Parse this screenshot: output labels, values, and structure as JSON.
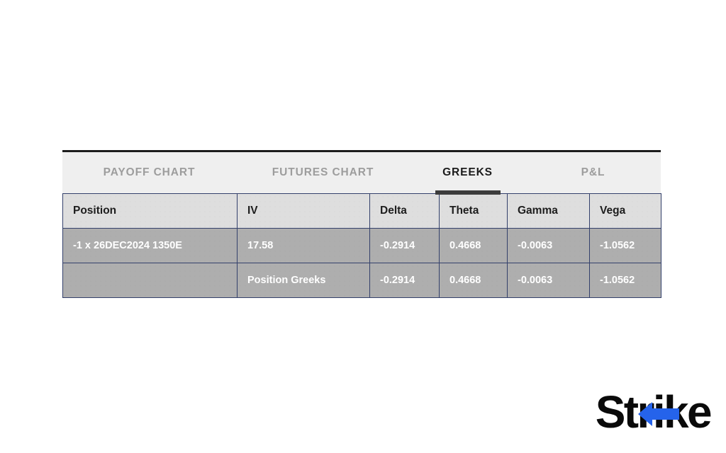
{
  "background": {
    "type": "world-map",
    "base_color": "#ffffff",
    "land_color": "#f1f2f4",
    "dot_color": "#e6e8ec"
  },
  "widget": {
    "tabs": [
      {
        "label": "PAYOFF CHART",
        "active": false,
        "name": "tab-payoff-chart"
      },
      {
        "label": "FUTURES CHART",
        "active": false,
        "name": "tab-futures-chart"
      },
      {
        "label": "GREEKS",
        "active": true,
        "name": "tab-greeks"
      },
      {
        "label": "P&L",
        "active": false,
        "name": "tab-pnl"
      }
    ],
    "active_tab": "GREEKS",
    "table": {
      "columns": [
        "Position",
        "IV",
        "Delta",
        "Theta",
        "Gamma",
        "Vega"
      ],
      "rows": [
        {
          "position": "-1 x 26DEC2024  1350E",
          "iv": "17.58",
          "delta": "-0.2914",
          "theta": "0.4668",
          "gamma": "-0.0063",
          "vega": "-1.0562"
        },
        {
          "position": "",
          "iv": "Position Greeks",
          "delta": "-0.2914",
          "theta": "0.4668",
          "gamma": "-0.0063",
          "vega": "-1.0562"
        }
      ]
    },
    "colors": {
      "tab_strip_bg": "#efefef",
      "tab_strip_top_border": "#1c1c1c",
      "tab_inactive_text": "#9d9d9d",
      "tab_active_text": "#1b1b1b",
      "tab_active_underline": "#3c3c3c",
      "header_bg": "#dedede",
      "header_text": "#1d1d1d",
      "row_bg": "#aeaeae",
      "row_text": "#ffffff",
      "cell_border": "#33406b"
    }
  },
  "logo": {
    "word": "Strike",
    "text_color": "#0a0a0a",
    "accent_color": "#2563eb",
    "accent_shape": "left-arrow"
  }
}
